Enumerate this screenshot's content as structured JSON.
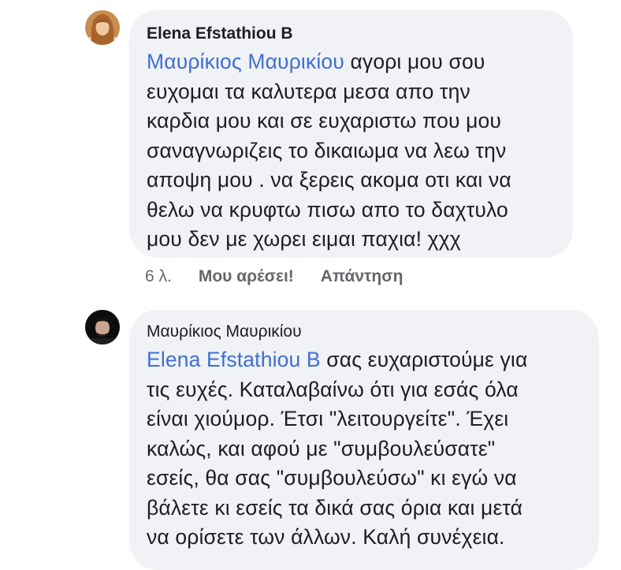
{
  "comments": [
    {
      "author": "Elena Efstathiou B",
      "mention": "Μαυρίκιος Μαυρικίου",
      "lines_first": " αγορι μου σου",
      "lines": [
        "ευχομαι τα καλυτερα μεσα απο την",
        "καρδια μου και σε ευχαριστω που μου",
        "σαναγνωριζεις το δικαιωμα να λεω την",
        "αποψη μου . να ξερεις ακομα οτι και να",
        "θελω να κρυφτω πισω απο το δαχτυλο",
        "μου δεν με χωρει ειμαι παχια! χχχ"
      ],
      "time": "6 λ.",
      "like_label": "Μου αρέσει!",
      "reply_label": "Απάντηση"
    },
    {
      "author": "Μαυρίκιος Μαυρικίου",
      "mention": "Elena Efstathiou B",
      "lines_first": " σας ευχαριστούμε για",
      "lines": [
        "τις ευχές. Καταλαβαίνω ότι για εσάς όλα",
        "είναι χιούμορ. Έτσι \"λειτουργείτε\". Έχει",
        "καλώς, και αφού με \"συμβουλεύσατε\"",
        "εσείς, θα σας \"συμβουλεύσω\" κι εγώ να",
        "βάλετε κι εσείς τα δικά σας όρια και μετά",
        "να ορίσετε των άλλων. Καλή συνέχεια."
      ]
    }
  ],
  "colors": {
    "bubble": "#f0f2f5",
    "mention": "#3f6fd1",
    "meta": "#65676b",
    "text": "#1c1e21"
  }
}
